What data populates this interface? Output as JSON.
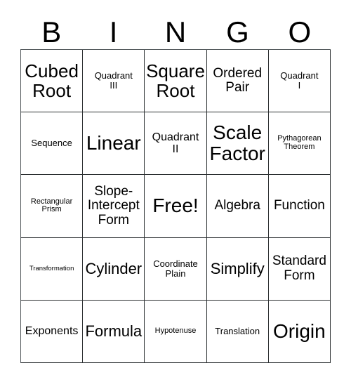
{
  "card": {
    "title_letters": [
      "B",
      "I",
      "N",
      "G",
      "O"
    ],
    "free_space_label": "Free!",
    "border_color": "#2b2f31",
    "background_color": "#ffffff",
    "text_color": "#000000",
    "rows": [
      [
        {
          "label": "Cubed\nRoot",
          "size": "s-xl"
        },
        {
          "label": "Quadrant\nIII",
          "size": "s-xs"
        },
        {
          "label": "Square\nRoot",
          "size": "s-xl"
        },
        {
          "label": "Ordered\nPair",
          "size": "s-md"
        },
        {
          "label": "Quadrant\nI",
          "size": "s-xs"
        }
      ],
      [
        {
          "label": "Sequence",
          "size": "s-xs"
        },
        {
          "label": "Linear",
          "size": "s-xxl"
        },
        {
          "label": "Quadrant\nII",
          "size": "s-sm"
        },
        {
          "label": "Scale\nFactor",
          "size": "s-xxl"
        },
        {
          "label": "Pythagorean\nTheorem",
          "size": "s-xxs"
        }
      ],
      [
        {
          "label": "Rectangular\nPrism",
          "size": "s-xxs"
        },
        {
          "label": "Slope-\nIntercept\nForm",
          "size": "s-md"
        },
        {
          "label": "Free!",
          "size": "s-xxl"
        },
        {
          "label": "Algebra",
          "size": "s-md"
        },
        {
          "label": "Function",
          "size": "s-md"
        }
      ],
      [
        {
          "label": "Transformation",
          "size": "s-tiny"
        },
        {
          "label": "Cylinder",
          "size": "s-lg"
        },
        {
          "label": "Coordinate\nPlain",
          "size": "s-xs"
        },
        {
          "label": "Simplify",
          "size": "s-lg"
        },
        {
          "label": "Standard\nForm",
          "size": "s-md"
        }
      ],
      [
        {
          "label": "Exponents",
          "size": "s-sm"
        },
        {
          "label": "Formula",
          "size": "s-lg"
        },
        {
          "label": "Hypotenuse",
          "size": "s-xxs"
        },
        {
          "label": "Translation",
          "size": "s-xs"
        },
        {
          "label": "Origin",
          "size": "s-xxl"
        }
      ]
    ]
  }
}
